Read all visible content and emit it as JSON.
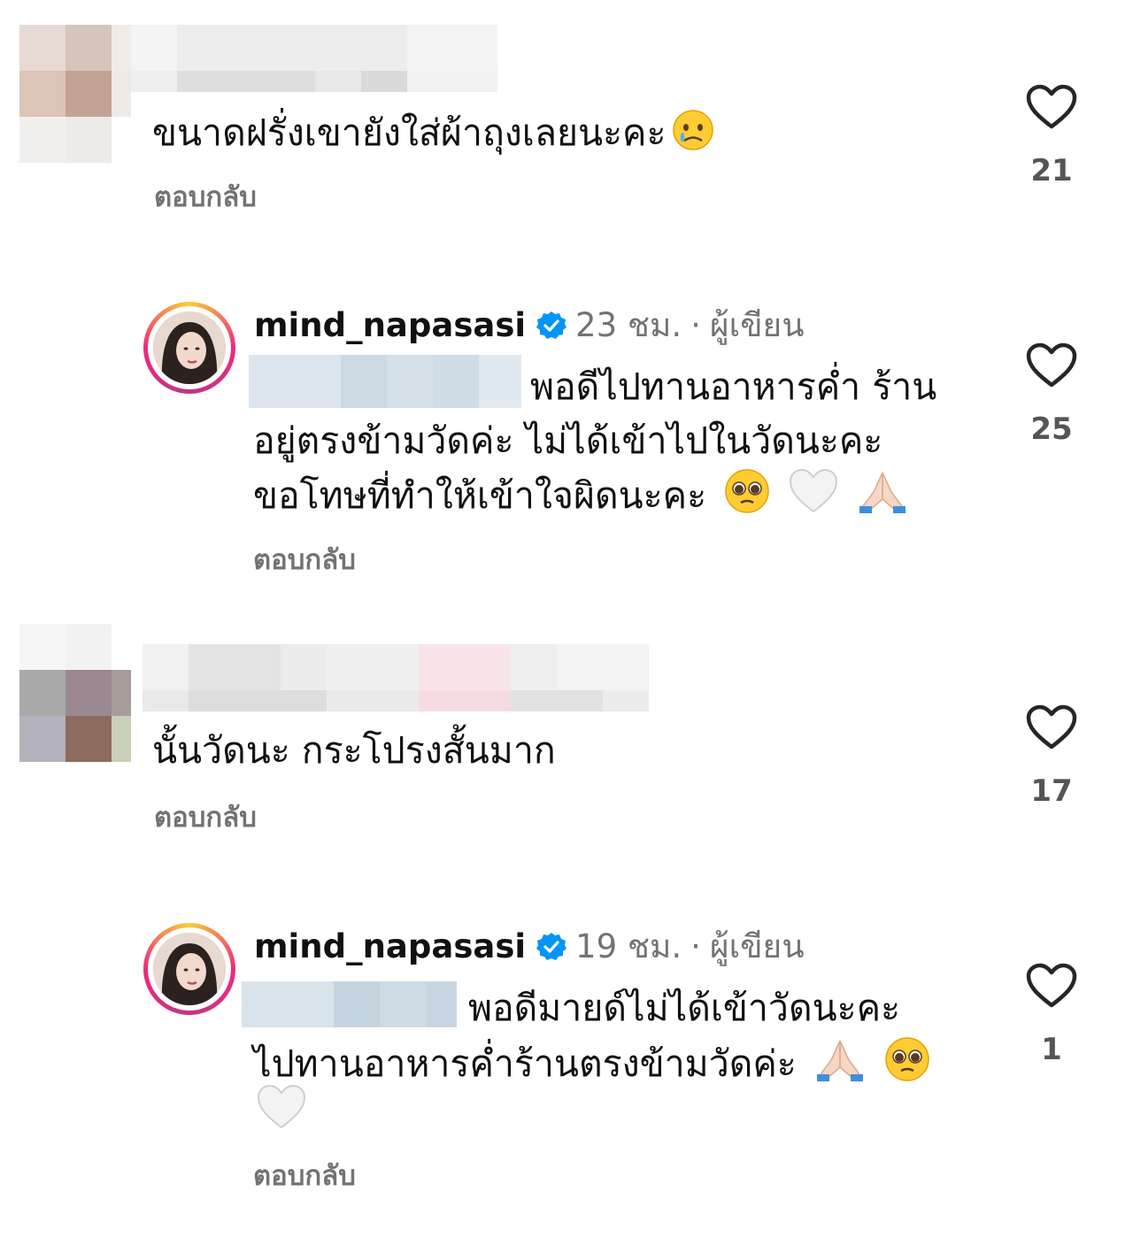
{
  "comments": [
    {
      "text": [
        "ขนาดฝรั่งเขายังใส่ผ้าถุงเลยนะคะ"
      ],
      "emoji": [
        "crying-face"
      ],
      "reply_label": "ตอบกลับ",
      "likes": "21"
    },
    {
      "username": "mind_napasasi",
      "time": "23 ชม.",
      "separator": "·",
      "role": "ผู้เขียน",
      "lines": [
        "พอดีไปทานอาหารค่ำ ร้าน",
        "อยู่ตรงข้ามวัดค่ะ ไม่ได้เข้าไปในวัดนะคะ",
        "ขอโทษที่ทำให้เข้าใจผิดนะคะ"
      ],
      "emoji": [
        "pleading-face",
        "white-heart",
        "folded-hands"
      ],
      "reply_label": "ตอบกลับ",
      "likes": "25"
    },
    {
      "text": [
        "นั้นวัดนะ กระโปรงสั้นมาก"
      ],
      "reply_label": "ตอบกลับ",
      "likes": "17"
    },
    {
      "username": "mind_napasasi",
      "time": "19 ชม.",
      "separator": "·",
      "role": "ผู้เขียน",
      "lines": [
        "พอดีมายด์ไม่ได้เข้าวัดนะคะ",
        "ไปทานอาหารค่ำร้านตรงข้ามวัดค่ะ"
      ],
      "emoji": [
        "folded-hands",
        "pleading-face",
        "white-heart"
      ],
      "reply_label": "ตอบกลับ",
      "likes": "1"
    }
  ],
  "colors": {
    "text": "#111111",
    "secondary": "#737373",
    "verified": "#0095f6",
    "like_icon": "#262626"
  },
  "icons": [
    "heart-outline-icon",
    "verified-badge-icon"
  ]
}
